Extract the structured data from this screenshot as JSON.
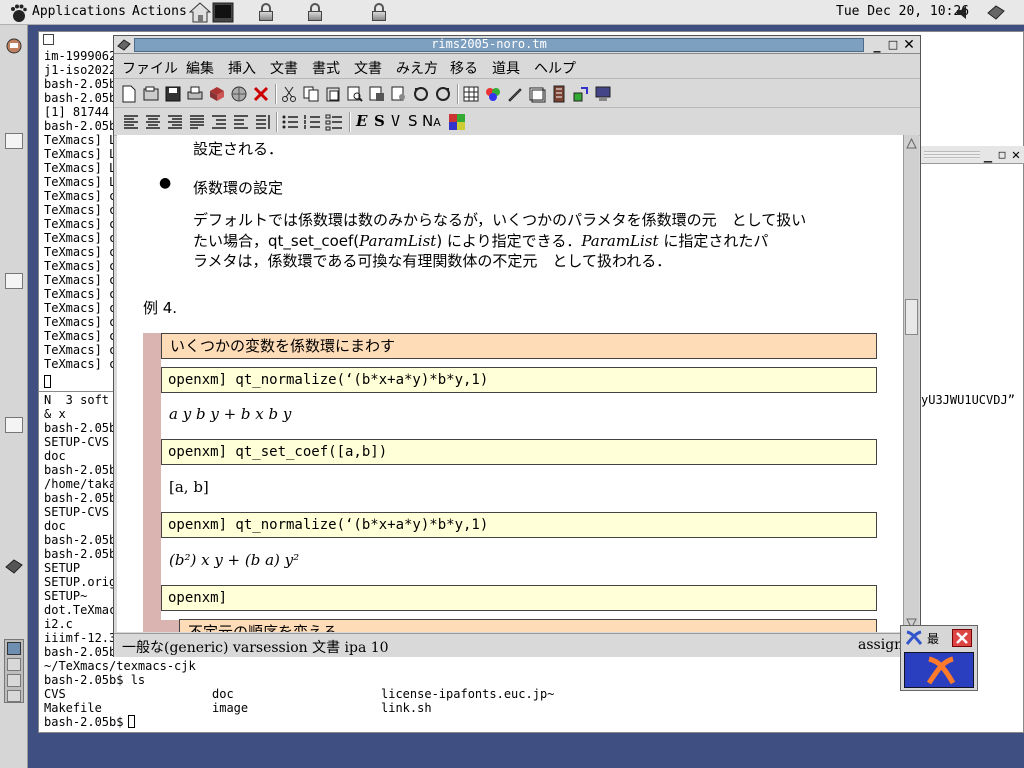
{
  "panel": {
    "applications_label": "Applications",
    "actions_label": "Actions",
    "clock": "Tue Dec 20, 10:26"
  },
  "terminal": {
    "lines_top": [
      "im-1999062",
      "j1-iso2022",
      "bash-2.05b",
      "bash-2.05b",
      "[1] 81744",
      "bash-2.05b",
      "TeXmacs] L",
      "TeXmacs] L",
      "TeXmacs] L",
      "TeXmacs] L",
      "TeXmacs] c",
      "TeXmacs] c",
      "TeXmacs] c",
      "TeXmacs] c",
      "TeXmacs] c",
      "TeXmacs] c",
      "TeXmacs] c",
      "TeXmacs] c",
      "TeXmacs] c",
      "TeXmacs] c",
      "TeXmacs] c",
      "TeXmacs] c",
      "TeXmacs] c"
    ],
    "lines_mid": [
      "N  3 soft",
      "& x",
      "bash-2.05b",
      "SETUP-CVS",
      "doc",
      "bash-2.05b",
      "/home/taka",
      "bash-2.05b",
      "SETUP-CVS",
      "doc",
      "bash-2.05b",
      "bash-2.05b",
      "SETUP",
      "SETUP.orig",
      "SETUP~",
      "dot.TeXmac",
      "i2.c",
      "iiimf-12.3",
      "bash-2.05b"
    ],
    "right_fragment": "yU3JWU1UCVDJ”",
    "bottom": {
      "line1": "~/TeXmacs/texmacs-cjk",
      "line2": "bash-2.05b$ ls",
      "ls_rows": [
        [
          "CVS",
          "doc",
          "license-ipafonts.euc.jp~"
        ],
        [
          "Makefile",
          "image",
          "link.sh"
        ]
      ],
      "prompt": "bash-2.05b$ "
    }
  },
  "texmacs": {
    "title": "rims2005-noro.tm",
    "menu": [
      "ファイル",
      "編集",
      "挿入",
      "文書",
      "書式",
      "文書",
      "みえ方",
      "移る",
      "道具",
      "ヘルプ"
    ],
    "format_chars": [
      "E",
      "S",
      "V",
      "S",
      "N",
      "A"
    ],
    "document": {
      "prev_tail": "設定される．",
      "bullet_heading": "係数環の設定",
      "para_line1": "デフォルトでは係数環は数のみからなるが，いくつかのパラメタを係数環の元　として扱い",
      "para_line2_a": "たい場合，qt_set_coef(",
      "para_line2_italic": "ParamList",
      "para_line2_b": ") により指定できる．",
      "para_line2_italic2": "ParamList",
      "para_line2_c": "に指定されたパ",
      "para_line3": "ラメタは，係数環である可換な有理関数体の不定元　として扱われる．",
      "example_label": "例 4.",
      "session_heading": "いくつかの変数を係数環にまわす",
      "inputs": [
        "openxm] qt_normalize(‘(b*x+a*y)*b*y,1)",
        "openxm] qt_set_coef([a,b])",
        "openxm] qt_normalize(‘(b*x+a*y)*b*y,1)",
        "openxm]"
      ],
      "outputs": [
        "a y b y + b x b y",
        "[a, b]",
        "(b²) x y + (b a) y²"
      ],
      "cut_heading": "不定元の順序を変える"
    },
    "status_left": "一般な(generic) varsession 文書 ipa 10",
    "status_right": "assign"
  },
  "widget": {
    "label": "最"
  }
}
